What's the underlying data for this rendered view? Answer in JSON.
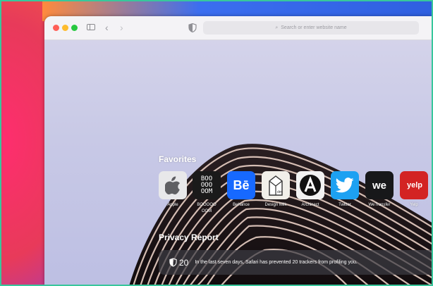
{
  "toolbar": {
    "address_placeholder": "Search or enter website name",
    "back_glyph": "‹",
    "forward_glyph": "›"
  },
  "start_page": {
    "favorites_title": "Favorites",
    "favorites": [
      {
        "label": "Apple",
        "icon": "apple-logo-icon"
      },
      {
        "label": "BOOOOOOOM",
        "tile_text": "BOO\nOOO\nOOM",
        "icon": "boooom-logo-icon"
      },
      {
        "label": "Behance",
        "tile_text": "Bē",
        "icon": "behance-logo-icon"
      },
      {
        "label": "Design Milk",
        "icon": "design-milk-logo-icon"
      },
      {
        "label": "Archinect",
        "icon": "archinect-logo-icon"
      },
      {
        "label": "Twitter",
        "icon": "twitter-logo-icon"
      },
      {
        "label": "WeTransfer",
        "tile_text": "we",
        "icon": "wetransfer-logo-icon"
      },
      {
        "label": "Yelp",
        "tile_text": "yelp",
        "icon": "yelp-logo-icon"
      }
    ],
    "privacy_title": "Privacy Report",
    "privacy_report": {
      "count": "20",
      "message": "In the last seven days, Safari has prevented 20 trackers from profiling you."
    }
  },
  "colors": {
    "traffic_red": "#ff5f57",
    "traffic_yellow": "#febc2e",
    "traffic_green": "#28c840",
    "behance": "#1769ff",
    "twitter": "#1da1f2",
    "yelp": "#d32323"
  }
}
